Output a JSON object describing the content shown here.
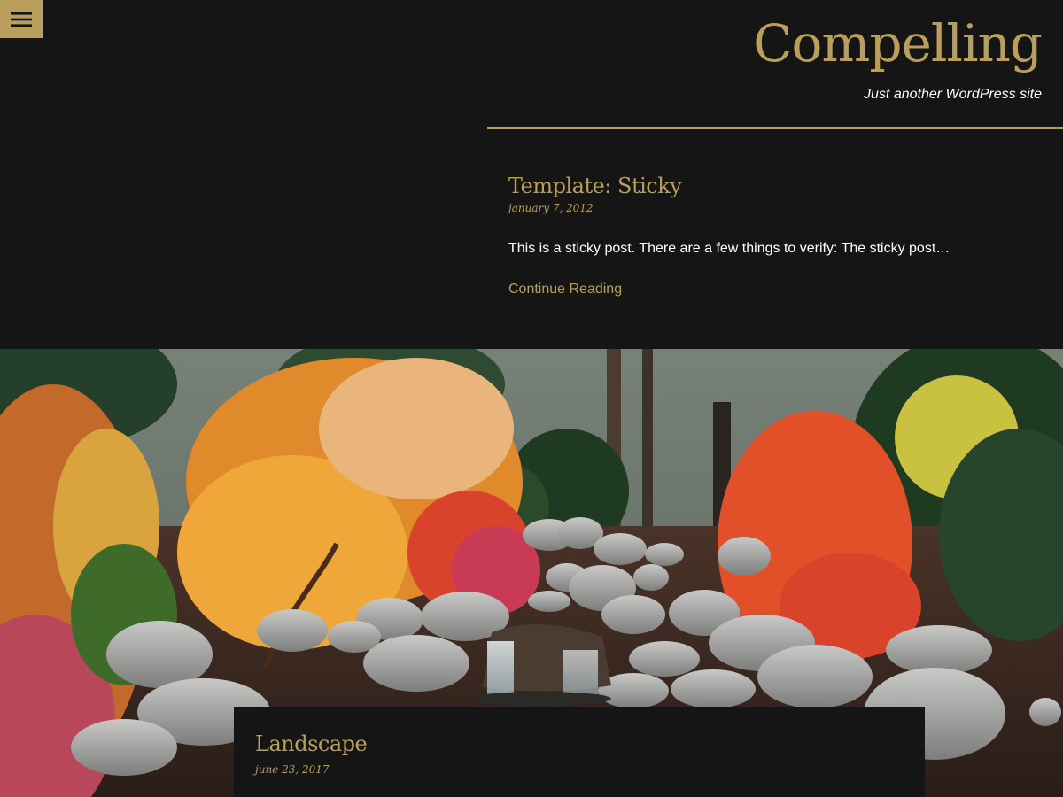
{
  "header": {
    "site_title": "Compelling",
    "tagline": "Just another WordPress site",
    "menu_icon": "hamburger-menu-icon"
  },
  "sticky_post": {
    "title": "Template: Sticky",
    "date": "january 7, 2012",
    "excerpt": "This is a sticky post. There are a few things to verify: The sticky post…",
    "continue_label": "Continue Reading"
  },
  "featured_post": {
    "title": "Landscape",
    "date": "june 23, 2017",
    "image_subject": "autumn-garden-waterfall-image"
  },
  "colors": {
    "background": "#151515",
    "accent": "#b99f5b",
    "text": "#ffffff"
  }
}
